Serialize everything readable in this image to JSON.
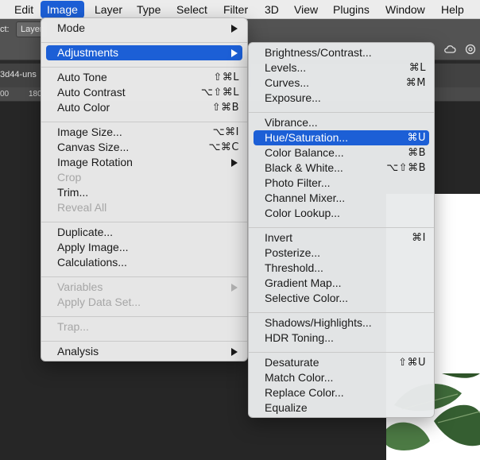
{
  "menubar": {
    "items": [
      "Edit",
      "Image",
      "Layer",
      "Type",
      "Select",
      "Filter",
      "3D",
      "View",
      "Plugins",
      "Window",
      "Help"
    ],
    "active": "Image"
  },
  "options_bar": {
    "label": "ct:",
    "select_value": "Layer"
  },
  "document_tab": {
    "title": "3d44-uns"
  },
  "ruler": {
    "labels": [
      "00",
      "180"
    ]
  },
  "image_menu": {
    "mode": "Mode",
    "adjustments": "Adjustments",
    "auto_tone": "Auto Tone",
    "auto_tone_sc": "⇧⌘L",
    "auto_contrast": "Auto Contrast",
    "auto_contrast_sc": "⌥⇧⌘L",
    "auto_color": "Auto Color",
    "auto_color_sc": "⇧⌘B",
    "image_size": "Image Size...",
    "image_size_sc": "⌥⌘I",
    "canvas_size": "Canvas Size...",
    "canvas_size_sc": "⌥⌘C",
    "image_rotation": "Image Rotation",
    "crop": "Crop",
    "trim": "Trim...",
    "reveal_all": "Reveal All",
    "duplicate": "Duplicate...",
    "apply_image": "Apply Image...",
    "calculations": "Calculations...",
    "variables": "Variables",
    "apply_data_set": "Apply Data Set...",
    "trap": "Trap...",
    "analysis": "Analysis"
  },
  "adjustments_menu": {
    "brightness_contrast": "Brightness/Contrast...",
    "levels": "Levels...",
    "levels_sc": "⌘L",
    "curves": "Curves...",
    "curves_sc": "⌘M",
    "exposure": "Exposure...",
    "vibrance": "Vibrance...",
    "hue_saturation": "Hue/Saturation...",
    "hue_saturation_sc": "⌘U",
    "color_balance": "Color Balance...",
    "color_balance_sc": "⌘B",
    "black_white": "Black & White...",
    "black_white_sc": "⌥⇧⌘B",
    "photo_filter": "Photo Filter...",
    "channel_mixer": "Channel Mixer...",
    "color_lookup": "Color Lookup...",
    "invert": "Invert",
    "invert_sc": "⌘I",
    "posterize": "Posterize...",
    "threshold": "Threshold...",
    "gradient_map": "Gradient Map...",
    "selective_color": "Selective Color...",
    "shadows_highlights": "Shadows/Highlights...",
    "hdr_toning": "HDR Toning...",
    "desaturate": "Desaturate",
    "desaturate_sc": "⇧⌘U",
    "match_color": "Match Color...",
    "replace_color": "Replace Color...",
    "equalize": "Equalize"
  },
  "colors": {
    "highlight": "#1c5fd6",
    "menu_bg": "#ececec",
    "workspace": "#262626"
  },
  "icons": [
    "cloud-icon",
    "gear-icon"
  ]
}
